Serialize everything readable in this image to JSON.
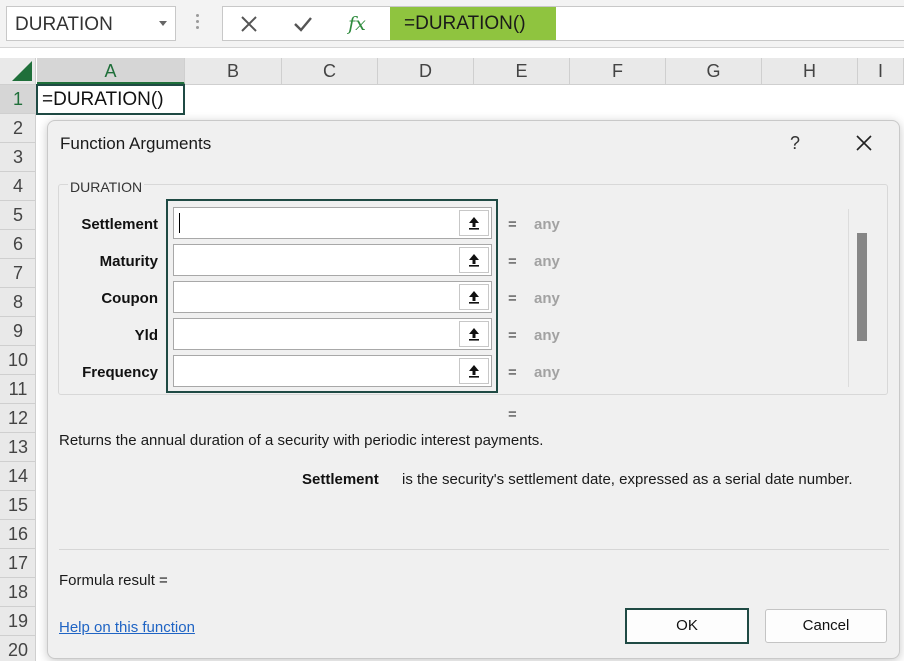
{
  "formula_bar": {
    "name_box": "DURATION",
    "formula": "=DURATION()",
    "fx_label": "fx"
  },
  "grid": {
    "columns": [
      "A",
      "B",
      "C",
      "D",
      "E",
      "F",
      "G",
      "H",
      "I"
    ],
    "rows": [
      "1",
      "2",
      "3",
      "4",
      "5",
      "6",
      "7",
      "8",
      "9",
      "10",
      "11",
      "12",
      "13",
      "14",
      "15",
      "16",
      "17",
      "18",
      "19",
      "20"
    ],
    "active_cell_value": "=DURATION()"
  },
  "dialog": {
    "title": "Function Arguments",
    "help_glyph": "?",
    "function_name": "DURATION",
    "arguments": [
      {
        "label": "Settlement",
        "value": "",
        "result": "any"
      },
      {
        "label": "Maturity",
        "value": "",
        "result": "any"
      },
      {
        "label": "Coupon",
        "value": "",
        "result": "any"
      },
      {
        "label": "Yld",
        "value": "",
        "result": "any"
      },
      {
        "label": "Frequency",
        "value": "",
        "result": "any"
      }
    ],
    "equals_sign": "=",
    "result_equals": "=",
    "description": "Returns the annual duration of a security with periodic interest payments.",
    "arg_description_label": "Settlement",
    "arg_description_text": "is the security's settlement date, expressed as a serial date number.",
    "formula_result_label": "Formula result =",
    "help_link": "Help on this function",
    "ok_label": "OK",
    "cancel_label": "Cancel"
  },
  "colors": {
    "accent_green": "#8fc43f",
    "highlight_border": "#1f4a44",
    "link_blue": "#1f64c4"
  }
}
